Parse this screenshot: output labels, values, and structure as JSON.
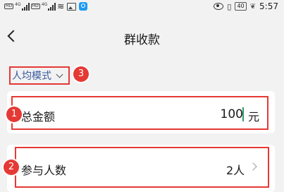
{
  "status_bar": {
    "time": "5:57",
    "battery": "40",
    "network": "4G"
  },
  "header": {
    "title": "群收款"
  },
  "mode": {
    "label": "人均模式"
  },
  "total": {
    "label": "总金额",
    "value": "100",
    "unit": "元"
  },
  "participants": {
    "label": "参与人数",
    "value": "2人"
  },
  "annotations": [
    "1",
    "2",
    "3"
  ],
  "colors": {
    "annotation": "#e53935",
    "mode_text": "#3a5ba0",
    "cursor": "#2e9e6a"
  }
}
